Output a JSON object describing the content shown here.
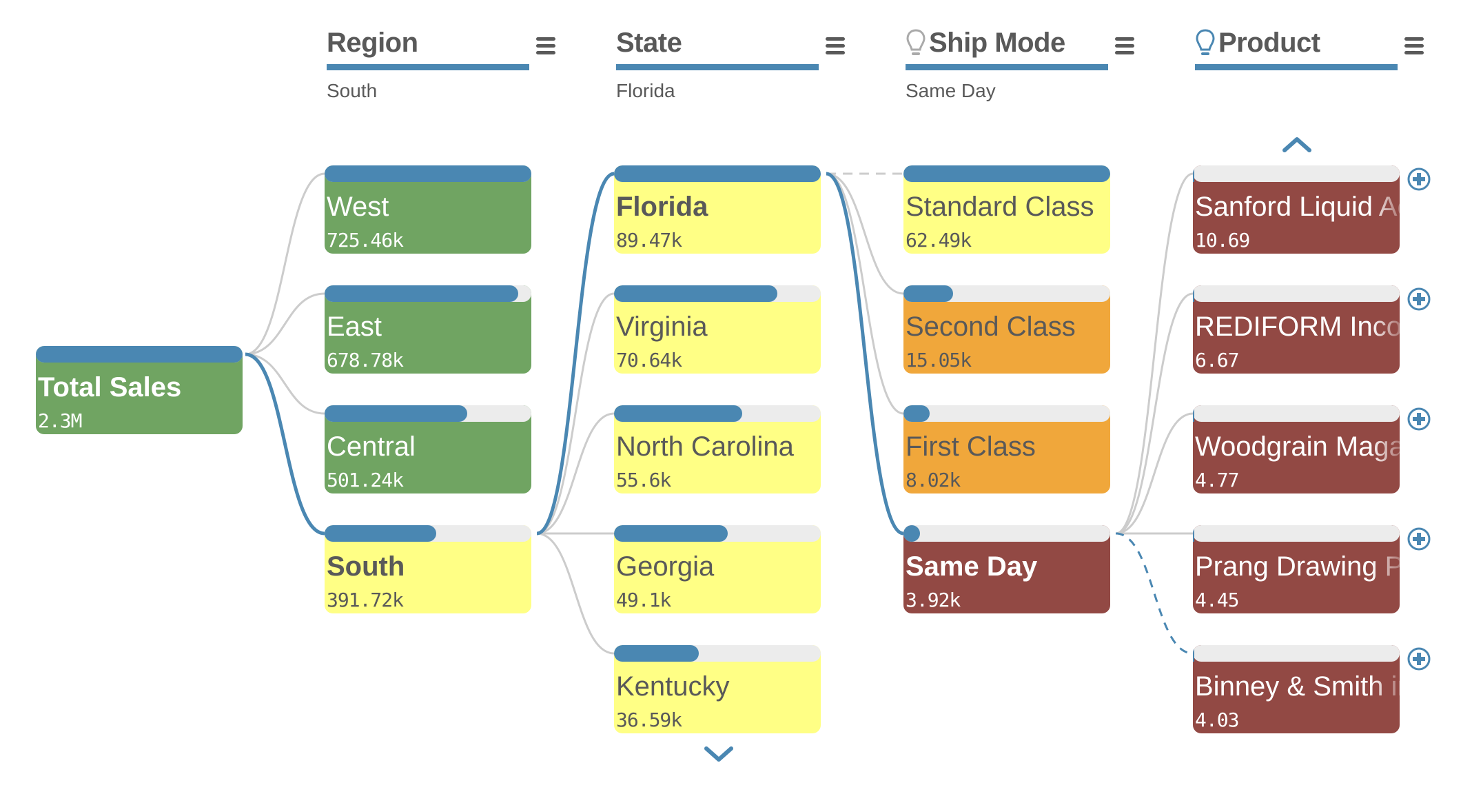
{
  "chart_type": "decomposition-tree",
  "colors": {
    "accent": "#4a87b2",
    "link": "#cccccc",
    "green": "#70a462",
    "yellow": "#ffff85",
    "orange": "#f0a73b",
    "red": "#924944",
    "text_dark": "#595959",
    "track": "#ececec"
  },
  "columns": [
    {
      "id": "region",
      "title": "Region",
      "selected": "South",
      "icon": null,
      "menu_icon": "hamburger-menu-icon"
    },
    {
      "id": "state",
      "title": "State",
      "selected": "Florida",
      "icon": null,
      "menu_icon": "hamburger-menu-icon"
    },
    {
      "id": "shipmode",
      "title": "Ship Mode",
      "selected": "Same Day",
      "icon": "lightbulb-icon",
      "icon_color": "#aaaaaa",
      "menu_icon": "hamburger-menu-icon"
    },
    {
      "id": "product",
      "title": "Product",
      "selected": "",
      "icon": "lightbulb-icon",
      "icon_color": "#4a87b2",
      "menu_icon": "hamburger-menu-icon"
    }
  ],
  "root": {
    "label": "Total Sales",
    "value": "2.3M",
    "fraction": 1.0,
    "color": "green"
  },
  "levels": [
    {
      "column": "region",
      "nodes": [
        {
          "label": "West",
          "value": "725.46k",
          "fraction": 1.0,
          "color": "green",
          "selected": false
        },
        {
          "label": "East",
          "value": "678.78k",
          "fraction": 0.936,
          "color": "green",
          "selected": false
        },
        {
          "label": "Central",
          "value": "501.24k",
          "fraction": 0.691,
          "color": "green",
          "selected": false
        },
        {
          "label": "South",
          "value": "391.72k",
          "fraction": 0.54,
          "color": "yellow",
          "selected": true
        }
      ]
    },
    {
      "column": "state",
      "nodes": [
        {
          "label": "Florida",
          "value": "89.47k",
          "fraction": 1.0,
          "color": "yellow",
          "selected": true
        },
        {
          "label": "Virginia",
          "value": "70.64k",
          "fraction": 0.79,
          "color": "yellow",
          "selected": false
        },
        {
          "label": "North Carolina",
          "value": "55.6k",
          "fraction": 0.621,
          "color": "yellow",
          "selected": false
        },
        {
          "label": "Georgia",
          "value": "49.1k",
          "fraction": 0.549,
          "color": "yellow",
          "selected": false
        },
        {
          "label": "Kentucky",
          "value": "36.59k",
          "fraction": 0.409,
          "color": "yellow",
          "selected": false
        }
      ],
      "scroll_down": "chevron-down-icon"
    },
    {
      "column": "shipmode",
      "nodes": [
        {
          "label": "Standard Class",
          "value": "62.49k",
          "fraction": 1.0,
          "color": "yellow",
          "selected": false
        },
        {
          "label": "Second Class",
          "value": "15.05k",
          "fraction": 0.241,
          "color": "orange",
          "selected": false
        },
        {
          "label": "First Class",
          "value": "8.02k",
          "fraction": 0.128,
          "color": "orange",
          "selected": false
        },
        {
          "label": "Same Day",
          "value": "3.92k",
          "fraction": 0.063,
          "color": "red",
          "selected": true
        }
      ]
    },
    {
      "column": "product",
      "nodes": [
        {
          "label": "Sanford Liquid Accent",
          "value": "10.69",
          "fraction": 0.0,
          "color": "red",
          "selected": false
        },
        {
          "label": "REDIFORM Incoming",
          "value": "6.67",
          "fraction": 0.0,
          "color": "red",
          "selected": false
        },
        {
          "label": "Woodgrain Magazine",
          "value": "4.77",
          "fraction": 0.0,
          "color": "red",
          "selected": false
        },
        {
          "label": "Prang Drawing Pencil",
          "value": "4.45",
          "fraction": 0.0,
          "color": "red",
          "selected": false
        },
        {
          "label": "Binney & Smith inkTank",
          "value": "4.03",
          "fraction": 0.0,
          "color": "red",
          "selected": false
        }
      ],
      "scroll_up": "chevron-up-icon",
      "expand_icon": "plus-circle-icon"
    }
  ]
}
